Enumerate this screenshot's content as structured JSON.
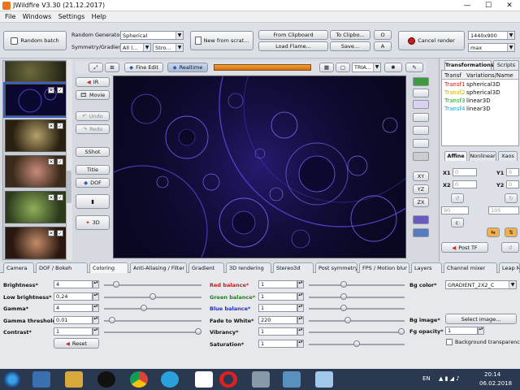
{
  "window": {
    "title": "JWildfire V3.30 (21.12.2017)",
    "minimize": "—",
    "maximize": "☐",
    "close": "✕"
  },
  "menu": [
    "File",
    "Windows",
    "Settings",
    "Help"
  ],
  "toolbar": {
    "random_batch": "Random batch",
    "random_generator_label": "Random Generator",
    "random_generator_value": "Spherical",
    "symmetry_label": "Symmetry/Gradient",
    "symmetry_value": "All (...",
    "stroke_value": "Stro...",
    "new_from_scratch": "New from scrat...",
    "from_clipboard": "From Clipboard",
    "to_clipboard": "To Clipbo...",
    "load_flame": "Load Flame...",
    "save": "Save...",
    "o_btn": "O",
    "a_btn": "A",
    "cancel_render": "Cancel render",
    "resolution_value": "1440x900",
    "quality_value": "max"
  },
  "preview_toolbar": {
    "fine_edit": "Fine Edit",
    "realtime": "Realtime",
    "tria": "TRIA..."
  },
  "sidebar": {
    "ir": "IR",
    "movie": "Movie",
    "undo": "Undo",
    "redo": "Redo",
    "sshot": "SShot",
    "title": "Title",
    "dof": "DOF",
    "three_d": "3D"
  },
  "right_tools": {
    "xy": "XY",
    "yz": "YZ",
    "zx": "ZX"
  },
  "right_panel": {
    "tabs": [
      "Transformations",
      "Scripts"
    ],
    "columns": [
      "Transf",
      "Variations/Name"
    ],
    "rows": [
      {
        "name": "Transf1",
        "variation": "spherical3D",
        "color": "#d22020"
      },
      {
        "name": "Transf2",
        "variation": "spherical3D",
        "color": "#c9b400"
      },
      {
        "name": "Transf3",
        "variation": "linear3D",
        "color": "#20a020"
      },
      {
        "name": "Transf4",
        "variation": "linear3D",
        "color": "#1fa4c8"
      }
    ],
    "sub_tabs": [
      "Affine",
      "Nonlinear",
      "Xaos"
    ],
    "coords": {
      "x1": "X1",
      "x1_val": "0",
      "y1": "Y1",
      "y1_val": "0",
      "x2": "X2",
      "x2_val": "0",
      "y2": "Y2",
      "y2_val": "0",
      "rot_val": "90",
      "scale_val": "105"
    },
    "post_tf": "Post TF"
  },
  "bottom_tabs": [
    "Camera",
    "DOF / Bokeh",
    "Coloring",
    "Anti-Aliasing / Filter",
    "Gradient",
    "3D rendering",
    "Stereo3d",
    "Post symmetry",
    "FPS / Motion blur",
    "Layers",
    "Channel mixer",
    "Leap M"
  ],
  "coloring": {
    "brightness": {
      "label": "Brightness*",
      "value": "4",
      "level": 0.1
    },
    "low_brightness": {
      "label": "Low brightness*",
      "value": "0,24",
      "level": 0.5
    },
    "gamma": {
      "label": "Gamma*",
      "value": "4",
      "level": 0.4
    },
    "gamma_threshold": {
      "label": "Gamma threshold*",
      "value": "0,01",
      "level": 0.05
    },
    "contrast": {
      "label": "Contrast*",
      "value": "1",
      "level": 1.0
    },
    "reset": "Reset",
    "red_balance": {
      "label": "Red balance*",
      "value": "1",
      "level": 0.35
    },
    "green_balance": {
      "label": "Green balance*",
      "value": "1",
      "level": 0.35
    },
    "blue_balance": {
      "label": "Blue balance*",
      "value": "1",
      "level": 0.35
    },
    "fade_to_white": {
      "label": "Fade to White*",
      "value": "220",
      "level": 0.4
    },
    "vibrancy": {
      "label": "Vibrancy*",
      "value": "1",
      "level": 1.0
    },
    "saturation": {
      "label": "Saturation*",
      "value": "1",
      "level": 0.5
    },
    "bg_color_label": "Bg color*",
    "bg_color_value": "GRADIENT_2X2_C",
    "bg_image_label": "Bg image*",
    "select_image": "Select image...",
    "fg_opacity_label": "Fg opacity*",
    "fg_opacity_value": "1",
    "bg_transparency": "Background transparency"
  },
  "taskbar": {
    "lang": "EN",
    "time": "20:14",
    "date": "06.02.2018"
  }
}
